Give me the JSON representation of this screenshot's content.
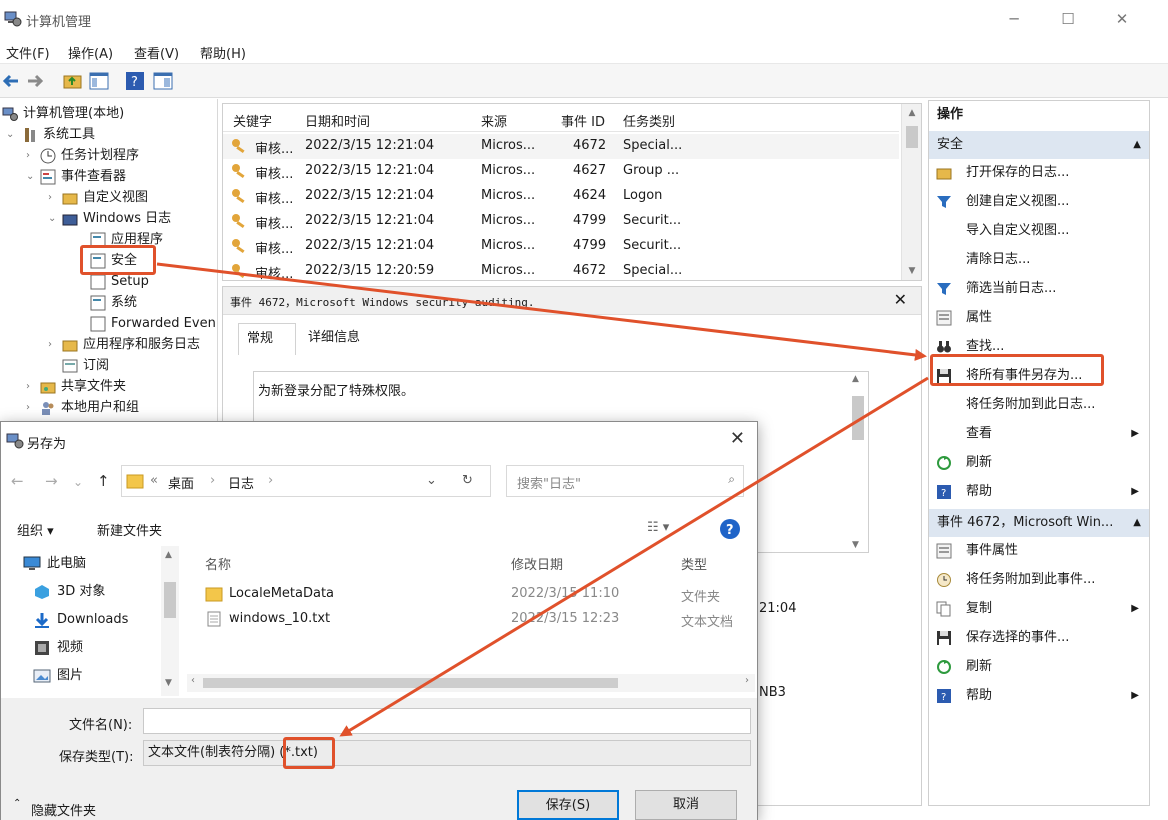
{
  "window": {
    "title": "计算机管理",
    "min": "─",
    "max": "☐",
    "close": "✕"
  },
  "menu": [
    "文件(F)",
    "操作(A)",
    "查看(V)",
    "帮助(H)"
  ],
  "toolbar_icons": [
    "back-arrow-icon",
    "forward-arrow-icon",
    "folder-up-icon",
    "show-hide-tree-icon",
    "help-icon",
    "properties-icon"
  ],
  "tree": {
    "root": "计算机管理(本地)",
    "system_tools": "系统工具",
    "task_scheduler": "任务计划程序",
    "event_viewer": "事件查看器",
    "custom_views": "自定义视图",
    "windows_logs": "Windows 日志",
    "application": "应用程序",
    "security": "安全",
    "setup": "Setup",
    "system": "系统",
    "forwarded": "Forwarded Even",
    "app_service_logs": "应用程序和服务日志",
    "subscriptions": "订阅",
    "shared_folders": "共享文件夹",
    "local_users": "本地用户和组"
  },
  "eventlist": {
    "headers": [
      "关键字",
      "日期和时间",
      "来源",
      "事件 ID",
      "任务类别"
    ],
    "rows": [
      [
        "审核...",
        "2022/3/15 12:21:04",
        "Micros...",
        "4672",
        "Special..."
      ],
      [
        "审核...",
        "2022/3/15 12:21:04",
        "Micros...",
        "4627",
        "Group ..."
      ],
      [
        "审核...",
        "2022/3/15 12:21:04",
        "Micros...",
        "4624",
        "Logon"
      ],
      [
        "审核...",
        "2022/3/15 12:21:04",
        "Micros...",
        "4799",
        "Securit..."
      ],
      [
        "审核...",
        "2022/3/15 12:21:04",
        "Micros...",
        "4799",
        "Securit..."
      ],
      [
        "审核...",
        "2022/3/15 12:20:59",
        "Micros...",
        "4672",
        "Special..."
      ]
    ]
  },
  "detail": {
    "title": "事件 4672，Microsoft Windows security auditing.",
    "close": "✕",
    "tab_general": "常规",
    "tab_details": "详细信息",
    "description": "为新登录分配了特殊权限。",
    "frag_time": "21:04",
    "frag_host": "NB3"
  },
  "actions": {
    "title": "操作",
    "section1": "安全",
    "items1": [
      {
        "icon": "folder-open-icon",
        "label": "打开保存的日志...",
        "sub": ""
      },
      {
        "icon": "filter-icon",
        "label": "创建自定义视图...",
        "sub": ""
      },
      {
        "icon": "",
        "label": "导入自定义视图...",
        "sub": ""
      },
      {
        "icon": "",
        "label": "清除日志...",
        "sub": ""
      },
      {
        "icon": "filter-icon",
        "label": "筛选当前日志...",
        "sub": ""
      },
      {
        "icon": "properties-icon",
        "label": "属性",
        "sub": ""
      },
      {
        "icon": "binoculars-icon",
        "label": "查找...",
        "sub": ""
      },
      {
        "icon": "save-icon",
        "label": "将所有事件另存为...",
        "sub": ""
      },
      {
        "icon": "",
        "label": "将任务附加到此日志...",
        "sub": ""
      },
      {
        "icon": "",
        "label": "查看",
        "sub": "▶"
      },
      {
        "icon": "refresh-icon",
        "label": "刷新",
        "sub": ""
      },
      {
        "icon": "help-icon",
        "label": "帮助",
        "sub": "▶"
      }
    ],
    "section2": "事件 4672，Microsoft Win...",
    "items2": [
      {
        "icon": "properties-icon",
        "label": "事件属性",
        "sub": ""
      },
      {
        "icon": "task-clock-icon",
        "label": "将任务附加到此事件...",
        "sub": ""
      },
      {
        "icon": "copy-icon",
        "label": "复制",
        "sub": "▶"
      },
      {
        "icon": "save-icon",
        "label": "保存选择的事件...",
        "sub": ""
      },
      {
        "icon": "refresh-icon",
        "label": "刷新",
        "sub": ""
      },
      {
        "icon": "help-icon",
        "label": "帮助",
        "sub": "▶"
      }
    ]
  },
  "saveas": {
    "title": "另存为",
    "close": "✕",
    "address": [
      "«",
      "桌面",
      "›",
      "日志",
      "›"
    ],
    "search_placeholder": "搜索\"日志\"",
    "organize": "组织 ▾",
    "new_folder": "新建文件夹",
    "nav": [
      "此电脑",
      "3D 对象",
      "Downloads",
      "视频",
      "图片"
    ],
    "columns": [
      "名称",
      "修改日期",
      "类型"
    ],
    "files": [
      {
        "name": "LocaleMetaData",
        "date": "2022/3/15 11:10",
        "type": "文件夹"
      },
      {
        "name": "windows_10.txt",
        "date": "2022/3/15 12:23",
        "type": "文本文档"
      }
    ],
    "filename_label": "文件名(N):",
    "filename_value": "",
    "filetype_label": "保存类型(T):",
    "filetype_value": "文本文件(制表符分隔) (*.txt)",
    "hide_folders": "隐藏文件夹",
    "save": "保存(S)",
    "cancel": "取消"
  },
  "colors": {
    "accent": "#0078d7",
    "annotation": "#e0512b",
    "section_bg": "#dde6f1"
  }
}
